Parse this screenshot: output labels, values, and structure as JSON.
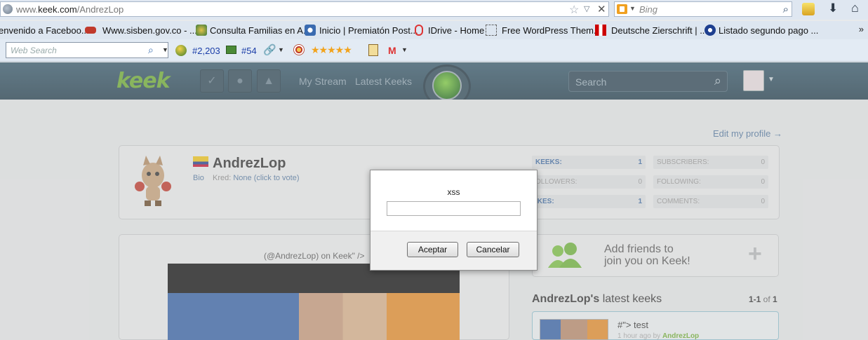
{
  "browser": {
    "url_prefix": "www.",
    "url_domain": "keek.com",
    "url_path": "/AndrezLop",
    "search_engine": "Bing",
    "bookmarks": [
      "envenido a Faceboo...",
      "Www.sisben.gov.co - ...",
      "Consulta Familias en A...",
      "Inicio | Premiatón Post...",
      "IDrive - Home",
      "Free WordPress Them...",
      "Deutsche Zierschrift | ...",
      "Listado segundo pago ..."
    ],
    "bookmarks_more": "»",
    "web_search_placeholder": "Web Search",
    "rank_global": "#2,203",
    "rank_local": "#54",
    "rating_stars": "★★★★★",
    "gmail_label": "M"
  },
  "site": {
    "logo": "keek",
    "nav": [
      "My Stream",
      "Latest Keeks"
    ],
    "search_placeholder": "Search",
    "edit_profile": "Edit my profile →",
    "profile": {
      "username": "AndrezLop",
      "bio_label": "Bio",
      "kred_label": "Kred:",
      "kred_value": "None (click to vote)",
      "stats": [
        {
          "label": "KEEKS:",
          "value": "1"
        },
        {
          "label": "SUBSCRIBERS:",
          "value": "0"
        },
        {
          "label": "OLLOWERS:",
          "value": "0"
        },
        {
          "label": "FOLLOWING:",
          "value": "0"
        },
        {
          "label": "IKES:",
          "value": "1"
        },
        {
          "label": "COMMENTS:",
          "value": "0"
        }
      ]
    },
    "video_caption": "(@AndrezLop) on Keek\" />",
    "add_friends": {
      "line1": "Add friends to",
      "line2": "join you on Keek!"
    },
    "latest": {
      "owner": "AndrezLop's",
      "title_rest": " latest keeks",
      "range": "1-1",
      "of_label": " of ",
      "total": "1",
      "item_title": "#\"> test",
      "item_time": "1 hour ago by ",
      "item_user": "AndrezLop"
    }
  },
  "dialog": {
    "message": "xss",
    "input_value": "",
    "ok_label": "Aceptar",
    "cancel_label": "Cancelar"
  }
}
